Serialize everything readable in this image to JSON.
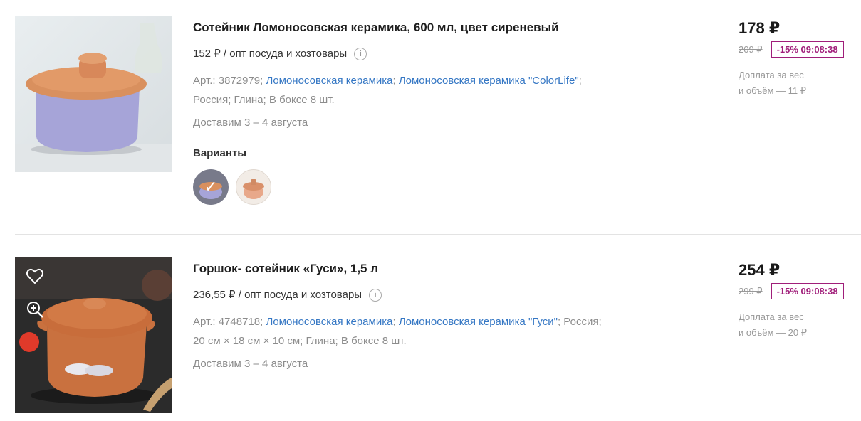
{
  "products": [
    {
      "title": "Сотейник Ломоносовская керамика, 600 мл, цвет сиреневый",
      "opt_price": "152 ₽ / опт посуда и хозтовары",
      "article": "Арт.: 3872979;",
      "brand": "Ломоносовская керамика",
      "series": "Ломоносовская керамика \"ColorLife\"",
      "props_line2": "Россия; Глина; В боксе 8 шт.",
      "delivery": "Доставим 3 – 4 августа",
      "variants_label": "Варианты",
      "price": "178 ₽",
      "old_price": "209 ₽",
      "discount": "-15% 09:08:38",
      "extra_line1": "Доплата за вес",
      "extra_line2": "и объём — 11 ₽"
    },
    {
      "title": "Горшок- сотейник «Гуси», 1,5 л",
      "opt_price": "236,55 ₽ / опт посуда и хозтовары",
      "article": "Арт.: 4748718;",
      "brand": "Ломоносовская керамика",
      "series": "Ломоносовская керамика \"Гуси\"",
      "props_country": "Россия;",
      "props_line2": "20 см × 18 см × 10 см; Глина; В боксе 8 шт.",
      "delivery": "Доставим 3 – 4 августа",
      "price": "254 ₽",
      "old_price": "299 ₽",
      "discount": "-15% 09:08:38",
      "extra_line1": "Доплата за вес",
      "extra_line2": "и объём — 20 ₽"
    }
  ],
  "colors": {
    "link": "#3577c4",
    "discount": "#a01e7a",
    "muted": "#8c8c8c"
  }
}
